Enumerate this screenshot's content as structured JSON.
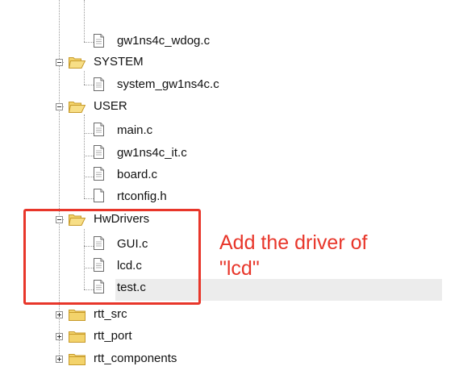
{
  "tree": {
    "items": [
      {
        "name": "gw1ns4c_wdog.c",
        "type": "file"
      },
      {
        "name": "SYSTEM",
        "type": "folder",
        "expanded": true
      },
      {
        "name": "system_gw1ns4c.c",
        "type": "file"
      },
      {
        "name": "USER",
        "type": "folder",
        "expanded": true
      },
      {
        "name": "main.c",
        "type": "file"
      },
      {
        "name": "gw1ns4c_it.c",
        "type": "file"
      },
      {
        "name": "board.c",
        "type": "file"
      },
      {
        "name": "rtconfig.h",
        "type": "file"
      },
      {
        "name": "HwDrivers",
        "type": "folder",
        "expanded": true
      },
      {
        "name": "GUI.c",
        "type": "file"
      },
      {
        "name": "lcd.c",
        "type": "file"
      },
      {
        "name": "test.c",
        "type": "file",
        "selected": true
      },
      {
        "name": "rtt_src",
        "type": "folder",
        "expanded": false
      },
      {
        "name": "rtt_port",
        "type": "folder",
        "expanded": false
      },
      {
        "name": "rtt_components",
        "type": "folder",
        "expanded": false
      }
    ]
  },
  "annotation": {
    "text": "Add the driver of\n\"lcd\"",
    "color": "#e8362a"
  },
  "colors": {
    "folder_fill": "#f3d36b",
    "folder_stroke": "#c79a2a",
    "selection_bg": "#ececec"
  }
}
